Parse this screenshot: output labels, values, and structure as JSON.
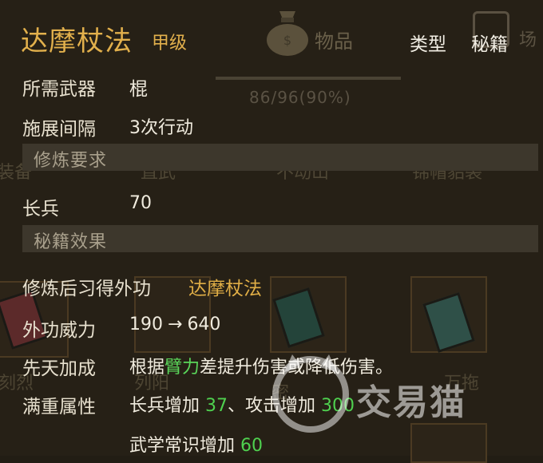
{
  "background": {
    "tab_items": "物品",
    "tab_next": "场",
    "capacity": "86/96(90%)",
    "categories": [
      "装备",
      "直武",
      "不动山",
      "锦帽貂裘"
    ],
    "item_labels": [
      "刻烈",
      "列阳",
      "密",
      "万拖"
    ]
  },
  "tooltip": {
    "title": "达摩杖法",
    "grade": "甲级",
    "type_label": "类型",
    "type_value": "秘籍",
    "weapon_label": "所需武器",
    "weapon_value": "棍",
    "interval_label": "施展间隔",
    "interval_value": "3次行动",
    "req_section": "修炼要求",
    "req_stat_label": "长兵",
    "req_stat_value": "70",
    "effect_section": "秘籍效果",
    "learn_label": "修炼后习得外功",
    "learn_value": "达摩杖法",
    "power_label": "外功威力",
    "power_from": "190",
    "power_arrow": "→",
    "power_to": "640",
    "innate_label": "先天加成",
    "innate_pre": "根据",
    "innate_highlight": "臂力",
    "innate_post": "差提升伤害或降低伤害。",
    "full_label": "满重属性",
    "full_line1_a": "长兵增加",
    "full_line1_a_val": "37",
    "full_line1_sep": "、",
    "full_line1_b": "攻击增加",
    "full_line1_b_val": "300",
    "full_line2_a": "武学常识增加",
    "full_line2_a_val": "60"
  },
  "watermark": {
    "text": "交易猫"
  },
  "colors": {
    "gold": "#e0ae46",
    "green": "#4fd04f",
    "section_bg": "#3d372c"
  }
}
